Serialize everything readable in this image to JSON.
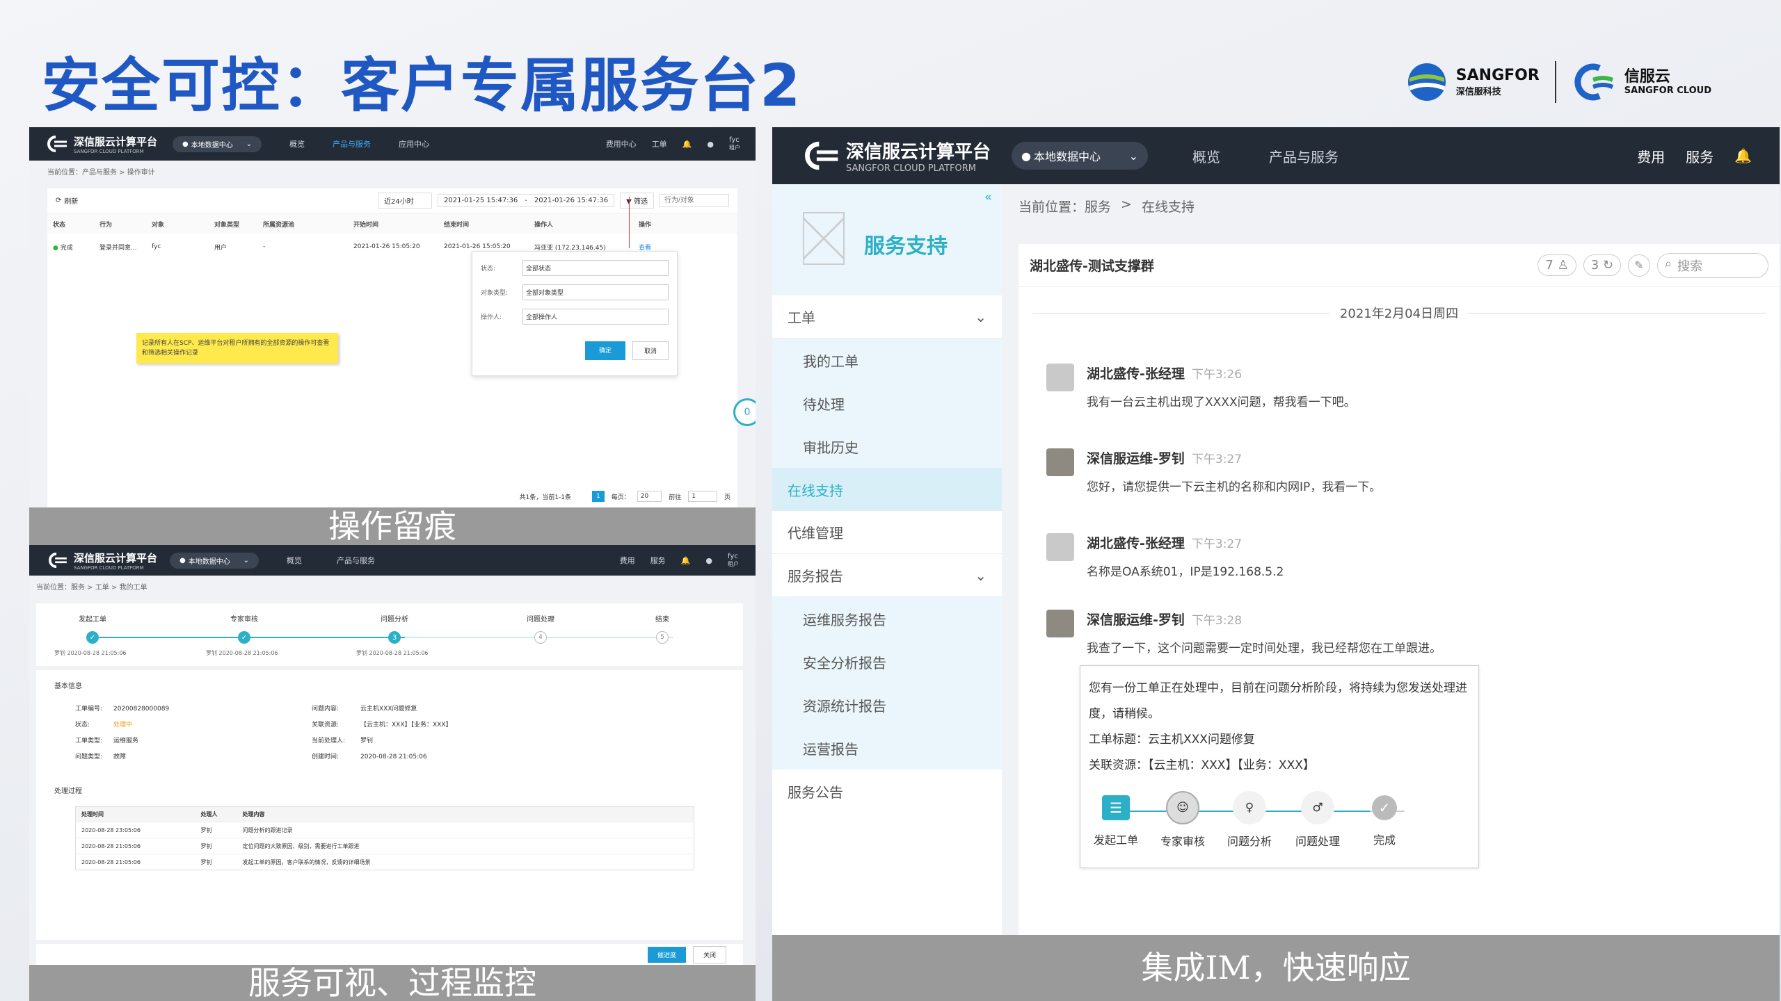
{
  "slide": {
    "title": "安全可控：客户专属服务台2",
    "logo_sangfor": "SANGFOR",
    "logo_sangfor_sub": "深信服科技",
    "logo_cloud": "信服云",
    "logo_cloud_sub": "SANGFOR CLOUD"
  },
  "platform": {
    "name": "深信服云计算平台",
    "sub": "SANGFOR CLOUD PLATFORM",
    "datacenter": "本地数据中心",
    "user": "fyc",
    "user_role": "租户"
  },
  "panel_audit": {
    "caption": "操作留痕",
    "nav": [
      "概览",
      "产品与服务",
      "应用中心"
    ],
    "nav_right": [
      "费用中心",
      "工单"
    ],
    "breadcrumb": "当前位置：产品与服务 > 操作审计",
    "refresh": "刷新",
    "range": "近24小时",
    "date_from": "2021-01-25 15:47:36",
    "date_to": "2021-01-26 15:47:36",
    "filter": "筛选",
    "search_placeholder": "行为/对象",
    "columns": [
      "状态",
      "行为",
      "对象",
      "对象类型",
      "所属资源池",
      "开始时间",
      "结束时间",
      "操作人",
      "操作"
    ],
    "row": [
      "完成",
      "登录并同意...",
      "fyc",
      "用户",
      "-",
      "2021-01-26 15:05:20",
      "2021-01-26 15:05:20",
      "冯亚亚 (172.23.146.45)",
      "查看"
    ],
    "filter_popup": {
      "fields": [
        {
          "label": "状态:",
          "value": "全部状态"
        },
        {
          "label": "对象类型:",
          "value": "全部对象类型"
        },
        {
          "label": "操作人:",
          "value": "全部操作人"
        }
      ],
      "ok": "确定",
      "cancel": "取消"
    },
    "note": "记录所有人在SCP、运维平台对租户所拥有的全部资源的操作可查看和筛选相关操作记录",
    "pager": {
      "total": "共1条，当前1-1条",
      "page": "1",
      "per_page_label": "每页：",
      "per_page": "20",
      "goto_label": "前往",
      "goto": "1",
      "page_suffix": "页"
    },
    "side_badge": "0"
  },
  "panel_ticket": {
    "caption": "服务可视、过程监控",
    "nav": [
      "概览",
      "产品与服务"
    ],
    "nav_right": [
      "费用",
      "服务"
    ],
    "breadcrumb": "当前位置：服务 > 工单 > 我的工单",
    "steps": [
      {
        "label": "发起工单",
        "who": "罗钊 2020-08-28 21:05:06",
        "state": "done"
      },
      {
        "label": "专家审核",
        "who": "罗钊 2020-08-28 21:05:06",
        "state": "done"
      },
      {
        "label": "问题分析",
        "who": "罗钊 2020-08-28 21:05:06",
        "state": "current",
        "num": "3"
      },
      {
        "label": "问题处理",
        "who": "",
        "state": "todo",
        "num": "4"
      },
      {
        "label": "结束",
        "who": "",
        "state": "todo",
        "num": "5"
      }
    ],
    "basic_title": "基本信息",
    "basic_left": [
      {
        "k": "工单编号:",
        "v": "20200828000089"
      },
      {
        "k": "状态:",
        "v": "处理中"
      },
      {
        "k": "工单类型:",
        "v": "运维服务"
      },
      {
        "k": "问题类型:",
        "v": "故障"
      }
    ],
    "basic_right": [
      {
        "k": "问题内容:",
        "v": "云主机XXX问题修复"
      },
      {
        "k": "关联资源:",
        "v": "【云主机：XXX】【业务：XXX】"
      },
      {
        "k": "当前处理人:",
        "v": "罗钊"
      },
      {
        "k": "创建时间:",
        "v": "2020-08-28 21:05:06"
      }
    ],
    "process_title": "处理过程",
    "process_cols": [
      "处理时间",
      "处理人",
      "处理内容"
    ],
    "process_rows": [
      [
        "2020-08-28 23:05:06",
        "罗钊",
        "问题分析的跟进记录"
      ],
      [
        "2020-08-28 21:05:06",
        "罗钊",
        "定位问题的大致原因、级别，需要进行工单跟进"
      ],
      [
        "2020-08-28 21:05:06",
        "罗钊",
        "发起工单的原因，客户联系的情况，反馈的详细场景"
      ]
    ],
    "btn_primary": "催进度",
    "btn_close": "关闭"
  },
  "panel_im": {
    "caption": "集成IM，快速响应",
    "nav": [
      "概览",
      "产品与服务"
    ],
    "nav_right": [
      "费用",
      "服务"
    ],
    "breadcrumb": [
      "当前位置：服务",
      "在线支持"
    ],
    "side_title": "服务支持",
    "sidebar": [
      {
        "label": "工单",
        "type": "group"
      },
      {
        "label": "我的工单",
        "type": "sub"
      },
      {
        "label": "待处理",
        "type": "sub"
      },
      {
        "label": "审批历史",
        "type": "sub"
      },
      {
        "label": "在线支持",
        "type": "active"
      },
      {
        "label": "代维管理",
        "type": "item"
      },
      {
        "label": "服务报告",
        "type": "group"
      },
      {
        "label": "运维服务报告",
        "type": "sub"
      },
      {
        "label": "安全分析报告",
        "type": "sub"
      },
      {
        "label": "资源统计报告",
        "type": "sub"
      },
      {
        "label": "运营报告",
        "type": "sub"
      },
      {
        "label": "服务公告",
        "type": "item"
      }
    ],
    "group_name": "湖北盛传-测试支撑群",
    "member_count": "7",
    "pin_count": "3",
    "search_placeholder": "搜索",
    "date": "2021年2月04日周四",
    "messages": [
      {
        "name": "湖北盛传-张经理",
        "time": "下午3:26",
        "text": "我有一台云主机出现了XXXX问题，帮我看一下吧。"
      },
      {
        "name": "深信服运维-罗钊",
        "time": "下午3:27",
        "text": "您好，请您提供一下云主机的名称和内网IP，我看一下。"
      },
      {
        "name": "湖北盛传-张经理",
        "time": "下午3:27",
        "text": "名称是OA系统01，IP是192.168.5.2"
      },
      {
        "name": "深信服运维-罗钊",
        "time": "下午3:28",
        "text": "我查了一下，这个问题需要一定时间处理，我已经帮您在工单跟进。"
      }
    ],
    "card": {
      "line1": "您有一份工单正在处理中，目前在问题分析阶段，将持续为您发送处理进度，请稍候。",
      "line2": "工单标题：云主机XXX问题修复",
      "line3": "关联资源：【云主机：XXX】【业务：XXX】",
      "steps": [
        "发起工单",
        "专家审核",
        "问题分析",
        "问题处理",
        "完成"
      ]
    }
  }
}
